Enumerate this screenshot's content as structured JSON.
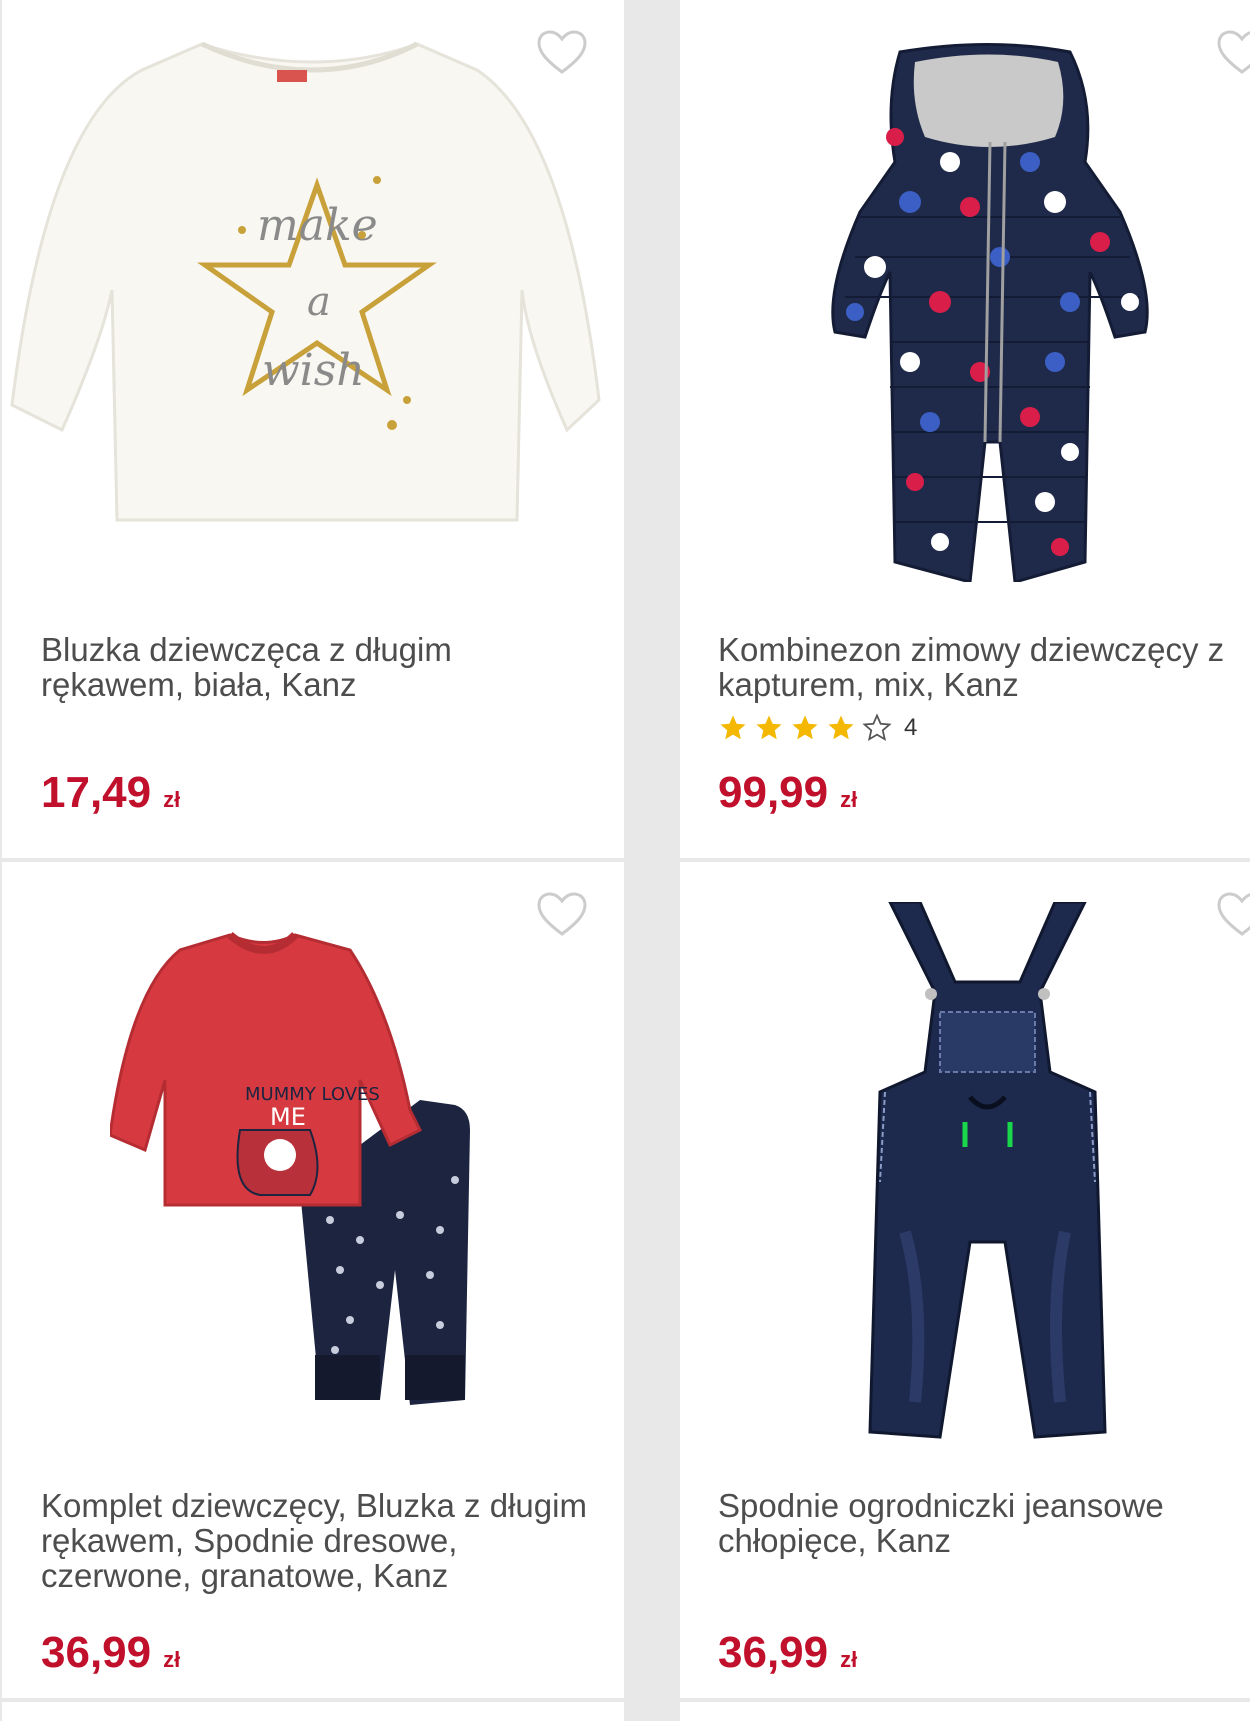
{
  "colors": {
    "price": "#c0102b",
    "title": "#4d4d4d",
    "star": "#f5b800",
    "heart": "#cccccc",
    "background": "#e8e8e8"
  },
  "products": [
    {
      "title": "Bluzka dziewczęca z długim rękawem, biała, Kanz",
      "price": "17,49",
      "currency": "zł",
      "image_icon": "white-longsleeve-star-print",
      "favorite_icon": "heart-outline-icon"
    },
    {
      "title": "Kombinezon zimowy dziewczęcy z kapturem, mix, Kanz",
      "rating": 4,
      "rating_max": 5,
      "rating_count": "4",
      "price": "99,99",
      "currency": "zł",
      "image_icon": "navy-polka-dot-snowsuit",
      "favorite_icon": "heart-outline-icon"
    },
    {
      "title": "Komplet dziewczęcy, Bluzka z długim rękawem, Spodnie dresowe, czerwone, granatowe, Kanz",
      "price": "36,99",
      "currency": "zł",
      "image_icon": "red-top-navy-pants-set",
      "favorite_icon": "heart-outline-icon"
    },
    {
      "title": "Spodnie ogrodniczki jeansowe chłopięce, Kanz",
      "price": "36,99",
      "currency": "zł",
      "image_icon": "denim-dungarees",
      "favorite_icon": "heart-outline-icon"
    }
  ]
}
